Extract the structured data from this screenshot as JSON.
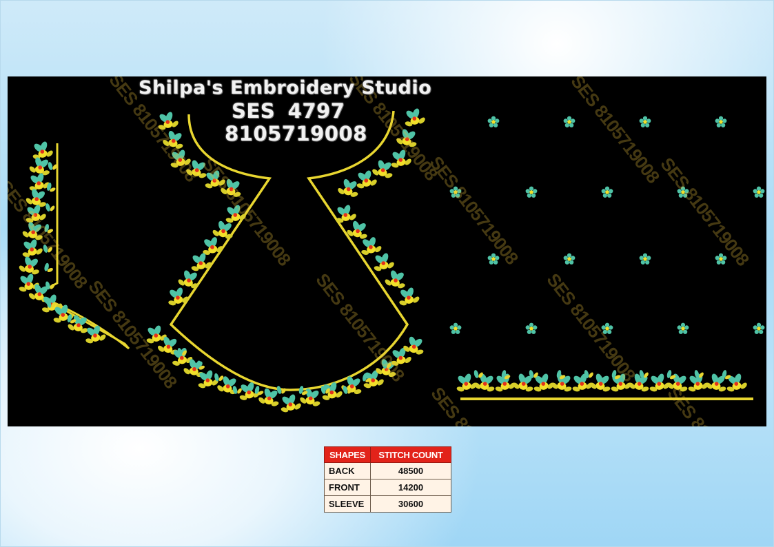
{
  "header": {
    "studio_name": "Shilpa's Embroidery Studio",
    "design_code": "SES 4797",
    "phone": "8105719008"
  },
  "watermark": {
    "texts": [
      "SES 8105719008",
      "SES 8105719008",
      "SES 8105719008",
      "SES 8105719008",
      "SES 8105719008",
      "SES 8105719008",
      "SES 8105719008",
      "SES 8105719008",
      "SES 8105719008",
      "SES 8105719008",
      "SES 8105719008",
      "SES 8105719008"
    ]
  },
  "stitch_table": {
    "headers": [
      "SHAPES",
      "STITCH COUNT"
    ],
    "rows": [
      {
        "shape": "BACK",
        "count": "48500"
      },
      {
        "shape": "FRONT",
        "count": "14200"
      },
      {
        "shape": "SLEEVE",
        "count": "30600"
      }
    ]
  },
  "colors": {
    "panel_background": "#000000",
    "border_gold": "#e8d630",
    "flower_yellow": "#f2e02a",
    "leaf_teal": "#4fc3a6",
    "petal_red": "#e2321c",
    "table_header": "#e2231a",
    "table_cell": "#fff3e6"
  }
}
